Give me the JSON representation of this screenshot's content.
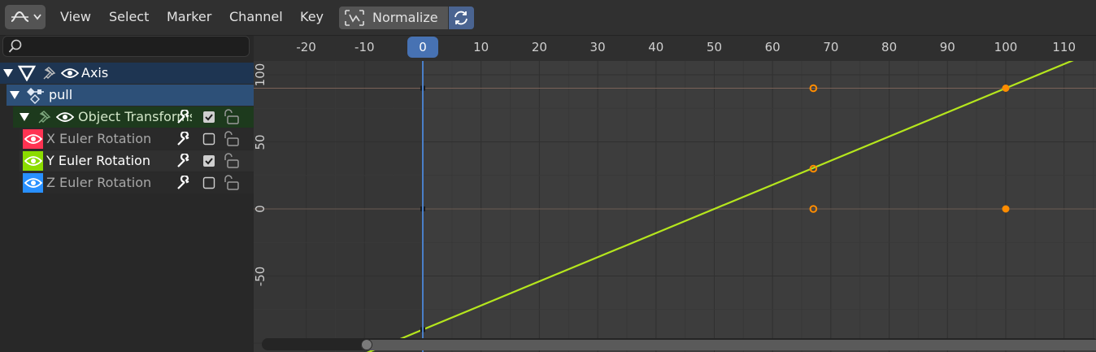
{
  "header": {
    "editor_type_icon": "graph-editor-icon",
    "menus": [
      "View",
      "Select",
      "Marker",
      "Channel",
      "Key"
    ],
    "normalize_label": "Normalize",
    "normalize_icon": "normalize-icon",
    "sync_icon": "sync-icon"
  },
  "channels": {
    "search_placeholder": "",
    "search_icon": "search-icon",
    "object": {
      "label": "Axis",
      "icon": "empty-object-icon"
    },
    "action": {
      "label": "pull",
      "icon": "action-icon"
    },
    "group": {
      "label": "Object Transforms",
      "checked": true
    },
    "curves": [
      {
        "label": "X Euler Rotation",
        "color": "#ff3352",
        "checked": false,
        "selected": false
      },
      {
        "label": "Y Euler Rotation",
        "color": "#8bdc00",
        "checked": true,
        "selected": true
      },
      {
        "label": "Z Euler Rotation",
        "color": "#2890ff",
        "checked": false,
        "selected": false
      }
    ]
  },
  "graph": {
    "frame_ticks": [
      "-20",
      "-10",
      "0",
      "10",
      "20",
      "30",
      "40",
      "50",
      "60",
      "70",
      "80",
      "90",
      "100",
      "110"
    ],
    "current_frame": "0",
    "value_ticks": [
      "100",
      "50",
      "0",
      "-50"
    ],
    "y_curve": {
      "color": "#b5e61d",
      "keyframes": [
        {
          "frame": 100,
          "value": 90
        }
      ],
      "description_points": [
        {
          "frame": 0,
          "value": -90
        },
        {
          "frame": 100,
          "value": 90
        }
      ]
    },
    "handles_color": "#ff8c00"
  }
}
